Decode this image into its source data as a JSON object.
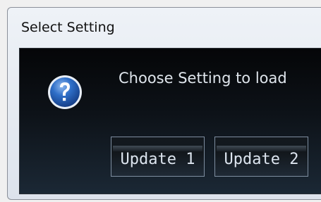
{
  "window": {
    "title": "Select Setting"
  },
  "dialog": {
    "icon": "question-icon",
    "message": "Choose Setting to load",
    "buttons": [
      {
        "label": "Update 1"
      },
      {
        "label": "Update 2"
      }
    ]
  },
  "colors": {
    "body_background": "#0d1218",
    "message_text": "#dfe5ec",
    "icon_blue": "#1f5fb8"
  }
}
